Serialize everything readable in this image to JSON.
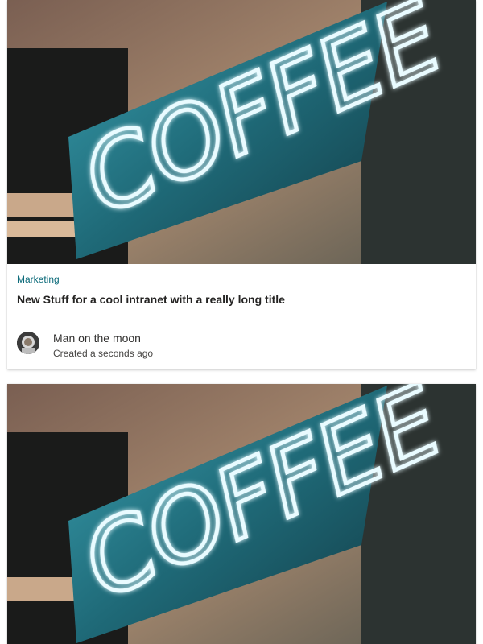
{
  "cards": [
    {
      "image_alt": "COFFEE neon sign",
      "image_text": "COFFEE",
      "category": "Marketing",
      "title": "New Stuff for a cool intranet with a really long title",
      "author_name": "Man on the moon",
      "created": "Created a seconds ago"
    },
    {
      "image_alt": "COFFEE neon sign",
      "image_text": "COFFEE"
    }
  ],
  "colors": {
    "category": "#0b6a79",
    "neon_panel": "#1f6a78",
    "neon_glow": "#e9fbff"
  },
  "icons": {
    "avatar": "astronaut-avatar-icon"
  }
}
